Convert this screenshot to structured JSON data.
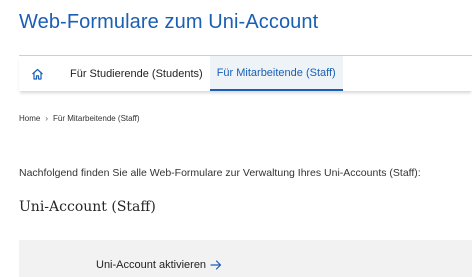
{
  "header": {
    "title": "Web-Formulare zum Uni-Account"
  },
  "nav": {
    "home_icon": "home-icon",
    "items": [
      {
        "label": "Für Studierende (Students)",
        "active": false
      },
      {
        "label": "Für Mitarbeitende (Staff)",
        "active": true
      }
    ]
  },
  "breadcrumb": {
    "home": "Home",
    "separator": "›",
    "current": "Für Mitarbeitende (Staff)"
  },
  "main": {
    "intro": "Nachfolgend finden Sie alle Web-Formulare zur Verwaltung Ihres Uni-Accounts (Staff):",
    "section_title": "Uni-Account (Staff)",
    "links": [
      {
        "label": "Uni-Account aktivieren",
        "icon": "arrow-right-icon"
      }
    ]
  },
  "colors": {
    "accent": "#1a5fb4",
    "active_tab_bg": "#eef3f8",
    "card_bg": "#f2f2f2"
  }
}
